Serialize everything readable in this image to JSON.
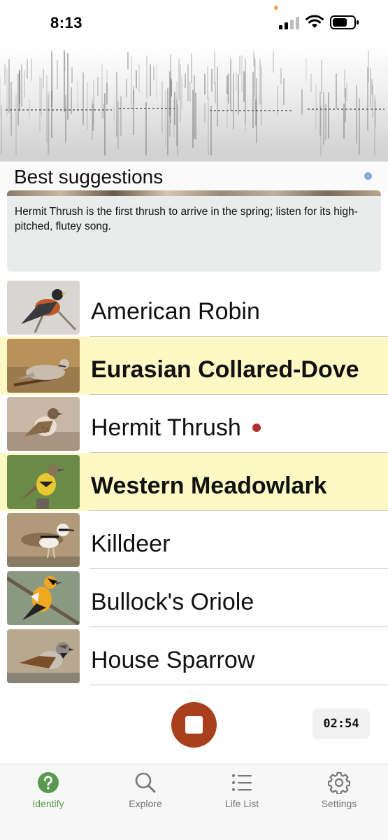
{
  "status_bar": {
    "time": "8:13",
    "icons": [
      "cellular-signal-icon",
      "wifi-icon",
      "battery-icon"
    ]
  },
  "spectrogram": {
    "icon": "audio-spectrogram"
  },
  "suggestions": {
    "title": "Best suggestions",
    "indicator_color": "#8aa8de",
    "card_text": "Hermit Thrush is the first thrush to arrive in the spring; listen for its high-pitched, flutey song."
  },
  "birds": [
    {
      "name": "American Robin",
      "highlighted": false,
      "live_dot": false
    },
    {
      "name": "Eurasian Collared-Dove",
      "highlighted": true,
      "live_dot": false
    },
    {
      "name": "Hermit Thrush",
      "highlighted": false,
      "live_dot": true
    },
    {
      "name": "Western Meadowlark",
      "highlighted": true,
      "live_dot": false
    },
    {
      "name": "Killdeer",
      "highlighted": false,
      "live_dot": false
    },
    {
      "name": "Bullock's Oriole",
      "highlighted": false,
      "live_dot": false
    },
    {
      "name": "House Sparrow",
      "highlighted": false,
      "live_dot": false
    }
  ],
  "recording": {
    "stop_icon": "stop-icon",
    "timer": "02:54",
    "button_color": "#a8401e"
  },
  "tabs": [
    {
      "label": "Identify",
      "icon": "question-circle-icon",
      "active": true
    },
    {
      "label": "Explore",
      "icon": "search-icon",
      "active": false
    },
    {
      "label": "Life List",
      "icon": "list-icon",
      "active": false
    },
    {
      "label": "Settings",
      "icon": "gear-icon",
      "active": false
    }
  ],
  "colors": {
    "highlight": "#fdf8c4",
    "accent_green": "#5a9a50",
    "live_dot": "#b03030"
  }
}
